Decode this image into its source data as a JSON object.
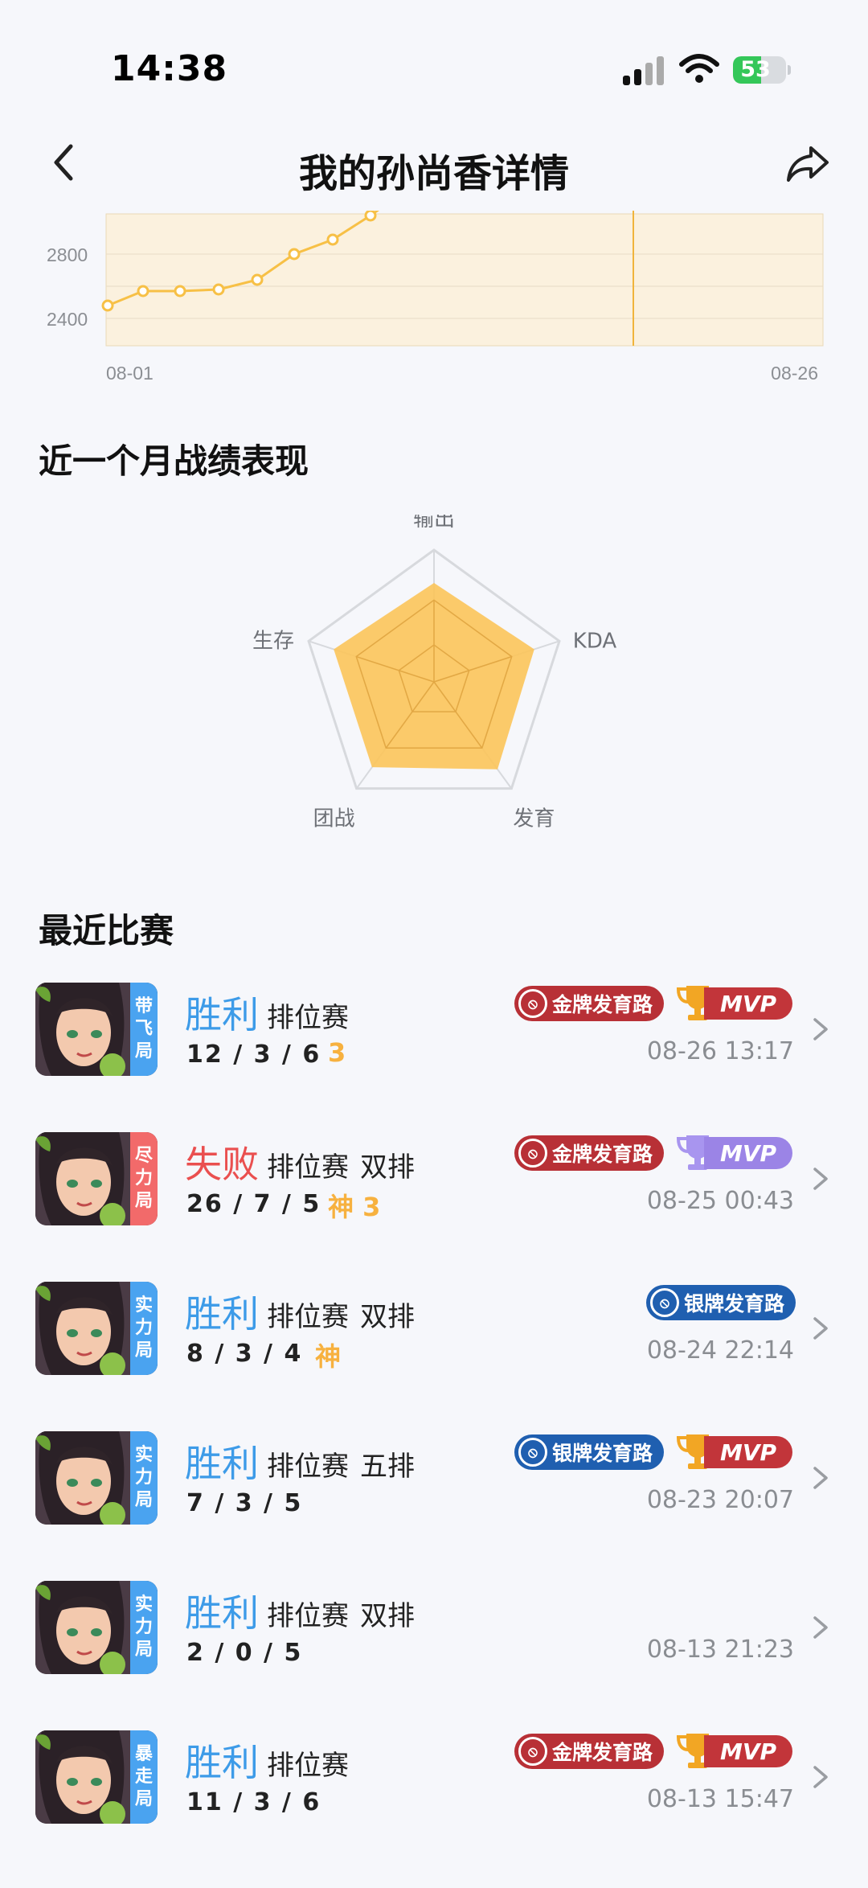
{
  "status_bar": {
    "time": "14:38",
    "battery": "53",
    "battery_level": 53
  },
  "header": {
    "title": "我的孙尚香详情"
  },
  "line_chart": {
    "y_ticks": [
      "2800",
      "2400"
    ],
    "x_start": "08-01",
    "x_end": "08-26",
    "colors": {
      "line": "#f7c046",
      "band": "#fbf1de",
      "marker": "#f0b43c"
    }
  },
  "radar_section": {
    "title": "近一个月战绩表现",
    "axes": [
      "输出",
      "KDA",
      "发育",
      "团战",
      "生存"
    ],
    "values": [
      0.75,
      0.8,
      0.82,
      0.8,
      0.8
    ],
    "colors": {
      "fill": "#fcc45a",
      "grid": "#d7d9dd"
    }
  },
  "matches_section": {
    "title": "最近比赛",
    "matches": [
      {
        "mode": [
          "带",
          "飞",
          "局"
        ],
        "mode_color": "blue",
        "result": "胜利",
        "outcome": "win",
        "type": "排位赛",
        "party": "",
        "kda": "12 / 3 / 6",
        "extra": "3",
        "badge": "金牌发育路",
        "badge_tier": "gold",
        "mvp": "MVP",
        "mvp_tier": "gold",
        "time": "08-26 13:17"
      },
      {
        "mode": [
          "尽",
          "力",
          "局"
        ],
        "mode_color": "red",
        "result": "失败",
        "outcome": "lose",
        "type": "排位赛",
        "party": "双排",
        "kda": "26 / 7 / 5",
        "extra": "神 3",
        "badge": "金牌发育路",
        "badge_tier": "gold",
        "mvp": "MVP",
        "mvp_tier": "purple",
        "time": "08-25 00:43"
      },
      {
        "mode": [
          "实",
          "力",
          "局"
        ],
        "mode_color": "blue",
        "result": "胜利",
        "outcome": "win",
        "type": "排位赛",
        "party": "双排",
        "kda": "8 / 3 / 4",
        "extra": "神",
        "badge": "银牌发育路",
        "badge_tier": "silver",
        "mvp": "",
        "mvp_tier": "",
        "time": "08-24 22:14"
      },
      {
        "mode": [
          "实",
          "力",
          "局"
        ],
        "mode_color": "blue",
        "result": "胜利",
        "outcome": "win",
        "type": "排位赛",
        "party": "五排",
        "kda": "7 / 3 / 5",
        "extra": "",
        "badge": "银牌发育路",
        "badge_tier": "silver",
        "mvp": "MVP",
        "mvp_tier": "gold",
        "time": "08-23 20:07"
      },
      {
        "mode": [
          "实",
          "力",
          "局"
        ],
        "mode_color": "blue",
        "result": "胜利",
        "outcome": "win",
        "type": "排位赛",
        "party": "双排",
        "kda": "2 / 0 / 5",
        "extra": "",
        "badge": "",
        "badge_tier": "",
        "mvp": "",
        "mvp_tier": "",
        "time": "08-13 21:23"
      },
      {
        "mode": [
          "暴",
          "走",
          "局"
        ],
        "mode_color": "blue",
        "result": "胜利",
        "outcome": "win",
        "type": "排位赛",
        "party": "",
        "kda": "11 / 3 / 6",
        "extra": "",
        "badge": "金牌发育路",
        "badge_tier": "gold",
        "mvp": "MVP",
        "mvp_tier": "gold",
        "time": "08-13 15:47"
      }
    ]
  }
}
